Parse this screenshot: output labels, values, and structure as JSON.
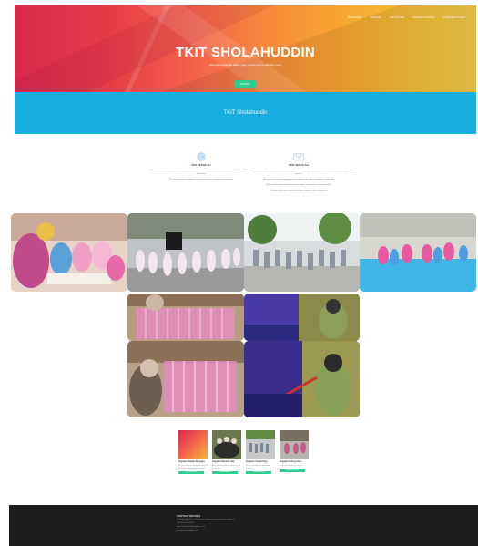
{
  "nav": {
    "items": [
      "BERANDA",
      "PROFIL",
      "KEGIATAN",
      "PENDAFTARAN",
      "HUBUNGI KAMI"
    ]
  },
  "hero": {
    "title": "TKIT SHOLAHUDDIN",
    "subtitle": "Membina generasi islami yang cerdas dan berakhlak mulia",
    "button_label": "MASUK"
  },
  "band": {
    "text": "TKIT Sholahuddin"
  },
  "features": [
    {
      "icon": "globe-icon",
      "title": "VISI SEKOLAH",
      "text": [
        "Terwujudnya generasi islami yang cerdas, kreatif, mandiri dan berakhlak mulia sesuai tuntunan Al-Quran dan Sunnah Rasulullah",
        "Menjadi lembaga pendidikan anak usia dini yang unggul dan terpercaya"
      ]
    },
    {
      "icon": "envelope-icon",
      "title": "MISI SEKOLAH",
      "text": [
        "Menyelenggarakan pendidikan yang menanamkan nilai-nilai keislaman sejak dini serta mengembangkan potensi anak secara optimal",
        "Membiasakan anak beribadah dan berakhlak mulia dalam kehidupan sehari-hari",
        "Menciptakan lingkungan belajar yang aman, nyaman dan menyenangkan",
        "Menjalin kerjasama yang baik dengan orang tua dan masyarakat"
      ]
    }
  ],
  "cards": [
    {
      "title": "Kegiatan Belajar Mengajar",
      "text": "Kegiatan belajar mengajar sehari-hari di TKIT Sholahuddin bersama ustadzah",
      "button": "SELENGKAPNYA"
    },
    {
      "title": "Kegiatan Manasik Haji",
      "text": "Anak-anak mengikuti kegiatan manasik haji bersama",
      "button": "SELENGKAPNYA"
    },
    {
      "title": "Kegiatan Senam Pagi",
      "text": "Senam pagi bersama di halaman sekolah",
      "button": "SELENGKAPNYA"
    },
    {
      "title": "Kegiatan Outing Class",
      "text": "Kunjungan belajar di luar kelas",
      "button": "SELENGKAPNYA"
    }
  ],
  "footer": {
    "title": "CONTACT DETAILS",
    "lines": [
      "Jl. Sholahuddin No. 1, Kecamatan, Kabupaten, Jawa Tengah, Indonesia",
      "Telp: (0271) 000 000",
      "Email: info@tkitsholahuddin.sch.id",
      "www.tkitsholahuddin.sch.id"
    ]
  },
  "colors": {
    "accent": "#2ecc8f",
    "band": "#18aee0",
    "footer": "#1d1d1f"
  }
}
